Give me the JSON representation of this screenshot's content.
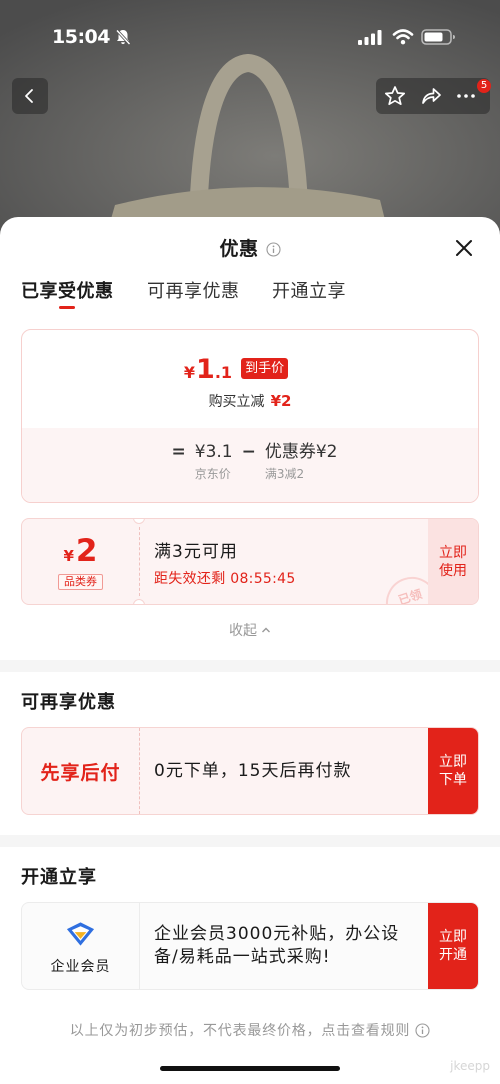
{
  "status_bar": {
    "time": "15:04"
  },
  "top_nav": {
    "more_badge": "5"
  },
  "sheet": {
    "title": "优惠",
    "tabs": [
      {
        "label": "已享受优惠",
        "active": true
      },
      {
        "label": "可再享优惠",
        "active": false
      },
      {
        "label": "开通立享",
        "active": false
      }
    ],
    "summary": {
      "price_currency": "¥",
      "price_integer": "1",
      "price_decimal": ".1",
      "price_tag": "到手价",
      "discount_label": "购买立减",
      "discount_amount": "¥2",
      "breakdown": {
        "equals": "=",
        "base_price": "¥3.1",
        "minus": "−",
        "coupon_value": "优惠券¥2",
        "base_price_label": "京东价",
        "coupon_rule": "满3减2"
      }
    },
    "coupon": {
      "currency": "¥",
      "amount": "2",
      "type": "品类券",
      "condition": "满3元可用",
      "countdown_label": "距失效还剩",
      "countdown": "08:55:45",
      "action": "立即使用",
      "stamp": "已领"
    },
    "collapse_label": "收起"
  },
  "more_offers": {
    "title": "可再享优惠",
    "item": {
      "name": "先享后付",
      "description": "0元下单，15天后再付款",
      "action": "立即下单"
    }
  },
  "membership": {
    "title": "开通立享",
    "item": {
      "name": "企业会员",
      "description": "企业会员3000元补贴，办公设备/易耗品一站式采购!",
      "action": "立即开通"
    }
  },
  "footer": {
    "note": "以上仅为初步预估，不代表最终价格，点击查看规则"
  },
  "watermark": "jkeepp",
  "icons": {
    "status_bar": [
      "bell-slash-icon",
      "signal-icon",
      "wifi-icon",
      "battery-icon"
    ],
    "top_nav": [
      "back-icon",
      "star-icon",
      "share-icon",
      "more-icon"
    ],
    "sheet": [
      "info-icon",
      "close-icon",
      "chevron-up-icon",
      "enterprise-member-icon"
    ]
  },
  "colors": {
    "accent": "#e2231a",
    "accent_soft_bg": "#fdf3f3",
    "coupon_button_bg": "#fbe2e1",
    "muted_text": "#999999",
    "member_icon_blue": "#2f6fe0",
    "member_icon_yellow": "#f5b323"
  }
}
